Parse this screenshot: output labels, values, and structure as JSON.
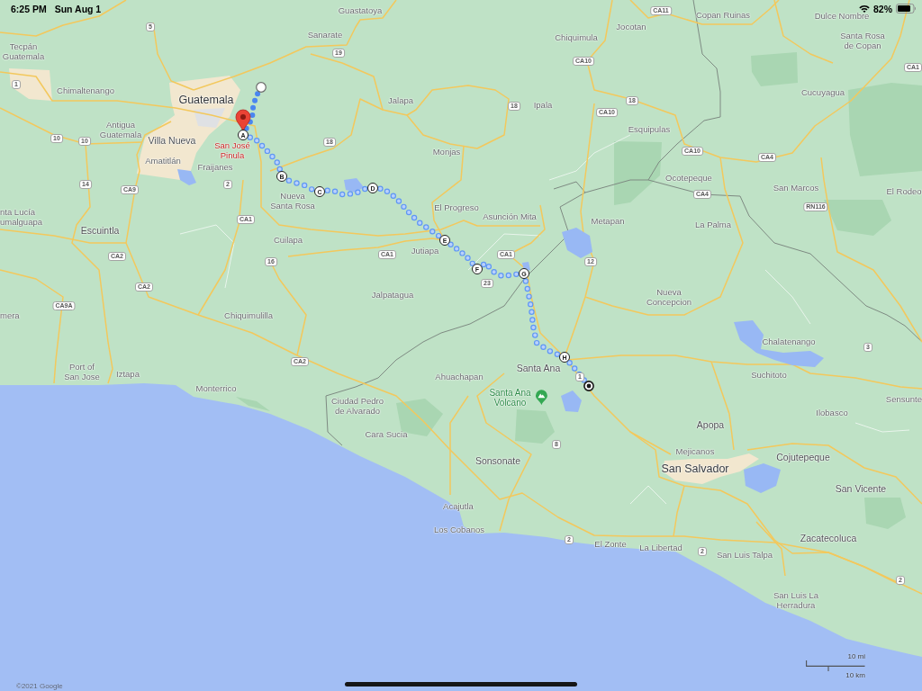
{
  "status_bar": {
    "time": "6:25 PM",
    "date": "Sun Aug 1",
    "battery": "82%"
  },
  "map": {
    "place_labels": [
      {
        "lines": [
          "Guastatoya"
        ],
        "kind": "town"
      },
      {
        "lines": [
          "Copan Ruinas"
        ],
        "kind": "town"
      },
      {
        "lines": [
          "Dulce Nombre"
        ],
        "kind": "town"
      },
      {
        "lines": [
          "Tecpán",
          "Guatemala"
        ],
        "kind": "town"
      },
      {
        "lines": [
          "Sanarate"
        ],
        "kind": "town"
      },
      {
        "lines": [
          "Chiquimula"
        ],
        "kind": "town"
      },
      {
        "lines": [
          "Jocotan"
        ],
        "kind": "town"
      },
      {
        "lines": [
          "Santa Rosa",
          "de Copan"
        ],
        "kind": "town"
      },
      {
        "lines": [
          "Chimaltenango"
        ],
        "kind": "town"
      },
      {
        "lines": [
          "Guatemala"
        ],
        "kind": "capital"
      },
      {
        "lines": [
          "Jalapa"
        ],
        "kind": "town"
      },
      {
        "lines": [
          "Ipala"
        ],
        "kind": "town"
      },
      {
        "lines": [
          "Cucuyagua"
        ],
        "kind": "town"
      },
      {
        "lines": [
          "Antigua",
          "Guatemala"
        ],
        "kind": "town"
      },
      {
        "lines": [
          "Esquipulas"
        ],
        "kind": "town"
      },
      {
        "lines": [
          "Villa Nueva"
        ],
        "kind": "city"
      },
      {
        "lines": [
          "Amatitlán"
        ],
        "kind": "town"
      },
      {
        "lines": [
          "Fraijanes"
        ],
        "kind": "town"
      },
      {
        "lines": [
          "San José",
          "Pinula"
        ],
        "kind": "selected"
      },
      {
        "lines": [
          "Monjas"
        ],
        "kind": "town"
      },
      {
        "lines": [
          "Ocotepeque"
        ],
        "kind": "town"
      },
      {
        "lines": [
          "nta Lucía",
          "umalguapa"
        ],
        "kind": "town"
      },
      {
        "lines": [
          "Nueva",
          "Santa Rosa"
        ],
        "kind": "town"
      },
      {
        "lines": [
          "San Marcos"
        ],
        "kind": "town"
      },
      {
        "lines": [
          "El Rodeo"
        ],
        "kind": "town"
      },
      {
        "lines": [
          "El Progreso"
        ],
        "kind": "town"
      },
      {
        "lines": [
          "Asunción Mita"
        ],
        "kind": "town"
      },
      {
        "lines": [
          "Escuintla"
        ],
        "kind": "city"
      },
      {
        "lines": [
          "Metapan"
        ],
        "kind": "town"
      },
      {
        "lines": [
          "La Palma"
        ],
        "kind": "town"
      },
      {
        "lines": [
          "Cuilapa"
        ],
        "kind": "town"
      },
      {
        "lines": [
          "Jutiapa"
        ],
        "kind": "town"
      },
      {
        "lines": [
          "Jalpatagua"
        ],
        "kind": "town"
      },
      {
        "lines": [
          "Nueva",
          "Concepcion"
        ],
        "kind": "town"
      },
      {
        "lines": [
          "mera"
        ],
        "kind": "town"
      },
      {
        "lines": [
          "Chiquimulilla"
        ],
        "kind": "town"
      },
      {
        "lines": [
          "Chalatenango"
        ],
        "kind": "town"
      },
      {
        "lines": [
          "Port of",
          "San Jose"
        ],
        "kind": "town"
      },
      {
        "lines": [
          "Iztapa"
        ],
        "kind": "town"
      },
      {
        "lines": [
          "Ahuachapan"
        ],
        "kind": "town"
      },
      {
        "lines": [
          "Santa Ana"
        ],
        "kind": "city"
      },
      {
        "lines": [
          "Suchitoto"
        ],
        "kind": "town"
      },
      {
        "lines": [
          "Monterrico"
        ],
        "kind": "town"
      },
      {
        "lines": [
          "Ciudad Pedro",
          "de Alvarado"
        ],
        "kind": "town"
      },
      {
        "lines": [
          "Santa Ana",
          "Volcano"
        ],
        "kind": "landmark"
      },
      {
        "lines": [
          "Sensunte"
        ],
        "kind": "town"
      },
      {
        "lines": [
          "Ilobasco"
        ],
        "kind": "town"
      },
      {
        "lines": [
          "Cara Sucia"
        ],
        "kind": "town"
      },
      {
        "lines": [
          "Apopa"
        ],
        "kind": "city"
      },
      {
        "lines": [
          "Sonsonate"
        ],
        "kind": "city"
      },
      {
        "lines": [
          "Mejicanos"
        ],
        "kind": "town"
      },
      {
        "lines": [
          "San Salvador"
        ],
        "kind": "capital"
      },
      {
        "lines": [
          "Cojutepeque"
        ],
        "kind": "city"
      },
      {
        "lines": [
          "San Vicente"
        ],
        "kind": "city"
      },
      {
        "lines": [
          "Acajutla"
        ],
        "kind": "town"
      },
      {
        "lines": [
          "Los Cobanos"
        ],
        "kind": "town"
      },
      {
        "lines": [
          "El Zonte"
        ],
        "kind": "town"
      },
      {
        "lines": [
          "La Libertad"
        ],
        "kind": "town"
      },
      {
        "lines": [
          "Zacatecoluca"
        ],
        "kind": "city"
      },
      {
        "lines": [
          "San Luis Talpa"
        ],
        "kind": "town"
      },
      {
        "lines": [
          "San Luis La",
          "Herradura"
        ],
        "kind": "town"
      }
    ],
    "road_shields": [
      "CA11",
      "5",
      "19",
      "CA10",
      "CA1",
      "1",
      "18",
      "CA10",
      "18",
      "10",
      "10",
      "18",
      "CA10",
      "CA4",
      "14",
      "CA9",
      "2",
      "CA4",
      "RN116",
      "CA1",
      "CA2",
      "16",
      "CA1",
      "CA1",
      "12",
      "CA2",
      "23",
      "CA9A",
      "3",
      "CA2",
      "1",
      "8",
      "2",
      "2",
      "2"
    ],
    "route": {
      "stops": [
        {
          "kind": "start"
        },
        {
          "kind": "waypoint",
          "label": "A",
          "pinned": true
        },
        {
          "kind": "waypoint",
          "label": "B",
          "pinned": false
        },
        {
          "kind": "waypoint",
          "label": "C",
          "pinned": false
        },
        {
          "kind": "waypoint",
          "label": "D",
          "pinned": false
        },
        {
          "kind": "waypoint",
          "label": "E",
          "pinned": false
        },
        {
          "kind": "waypoint",
          "label": "F",
          "pinned": false
        },
        {
          "kind": "waypoint",
          "label": "G",
          "pinned": false
        },
        {
          "kind": "waypoint",
          "label": "H",
          "pinned": false
        },
        {
          "kind": "end"
        }
      ]
    },
    "scale": {
      "miles": "10 mi",
      "kilometers": "10 km"
    },
    "attribution": "©2021 Google"
  }
}
